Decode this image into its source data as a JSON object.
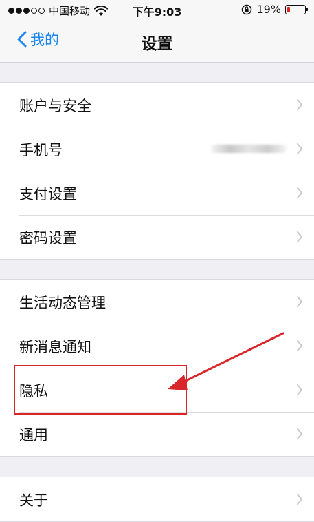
{
  "status_bar": {
    "carrier": "中国移动",
    "time": "下午9:03",
    "battery_percent": "19%",
    "battery_level": 0.19,
    "signal_strength": 3,
    "signal_max": 5
  },
  "nav": {
    "back_label": "我的",
    "title": "设置",
    "accent_color": "#1b86f0"
  },
  "groups": [
    {
      "items": [
        {
          "label": "账户与安全"
        },
        {
          "label": "手机号"
        },
        {
          "label": "支付设置"
        },
        {
          "label": "密码设置"
        }
      ]
    },
    {
      "items": [
        {
          "label": "生活动态管理"
        },
        {
          "label": "新消息通知"
        },
        {
          "label": "隐私"
        },
        {
          "label": "通用"
        }
      ]
    },
    {
      "items": [
        {
          "label": "关于"
        }
      ]
    }
  ],
  "annotation": {
    "highlight_color": "#d9262a",
    "highlighted_item": "隐私"
  }
}
